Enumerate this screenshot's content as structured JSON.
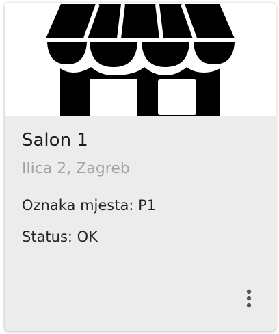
{
  "card": {
    "title": "Salon 1",
    "address": "Ilica 2, Zagreb",
    "place_label": "Oznaka mjesta: P1",
    "status_label": "Status: OK",
    "media_icon": "storefront-icon",
    "actions_icon": "more-vertical-icon"
  },
  "colors": {
    "card_background": "#ececec",
    "title_text": "#1b1b1b",
    "secondary_text": "#a3a3a3",
    "body_text": "#262626",
    "icon": "#000000"
  }
}
